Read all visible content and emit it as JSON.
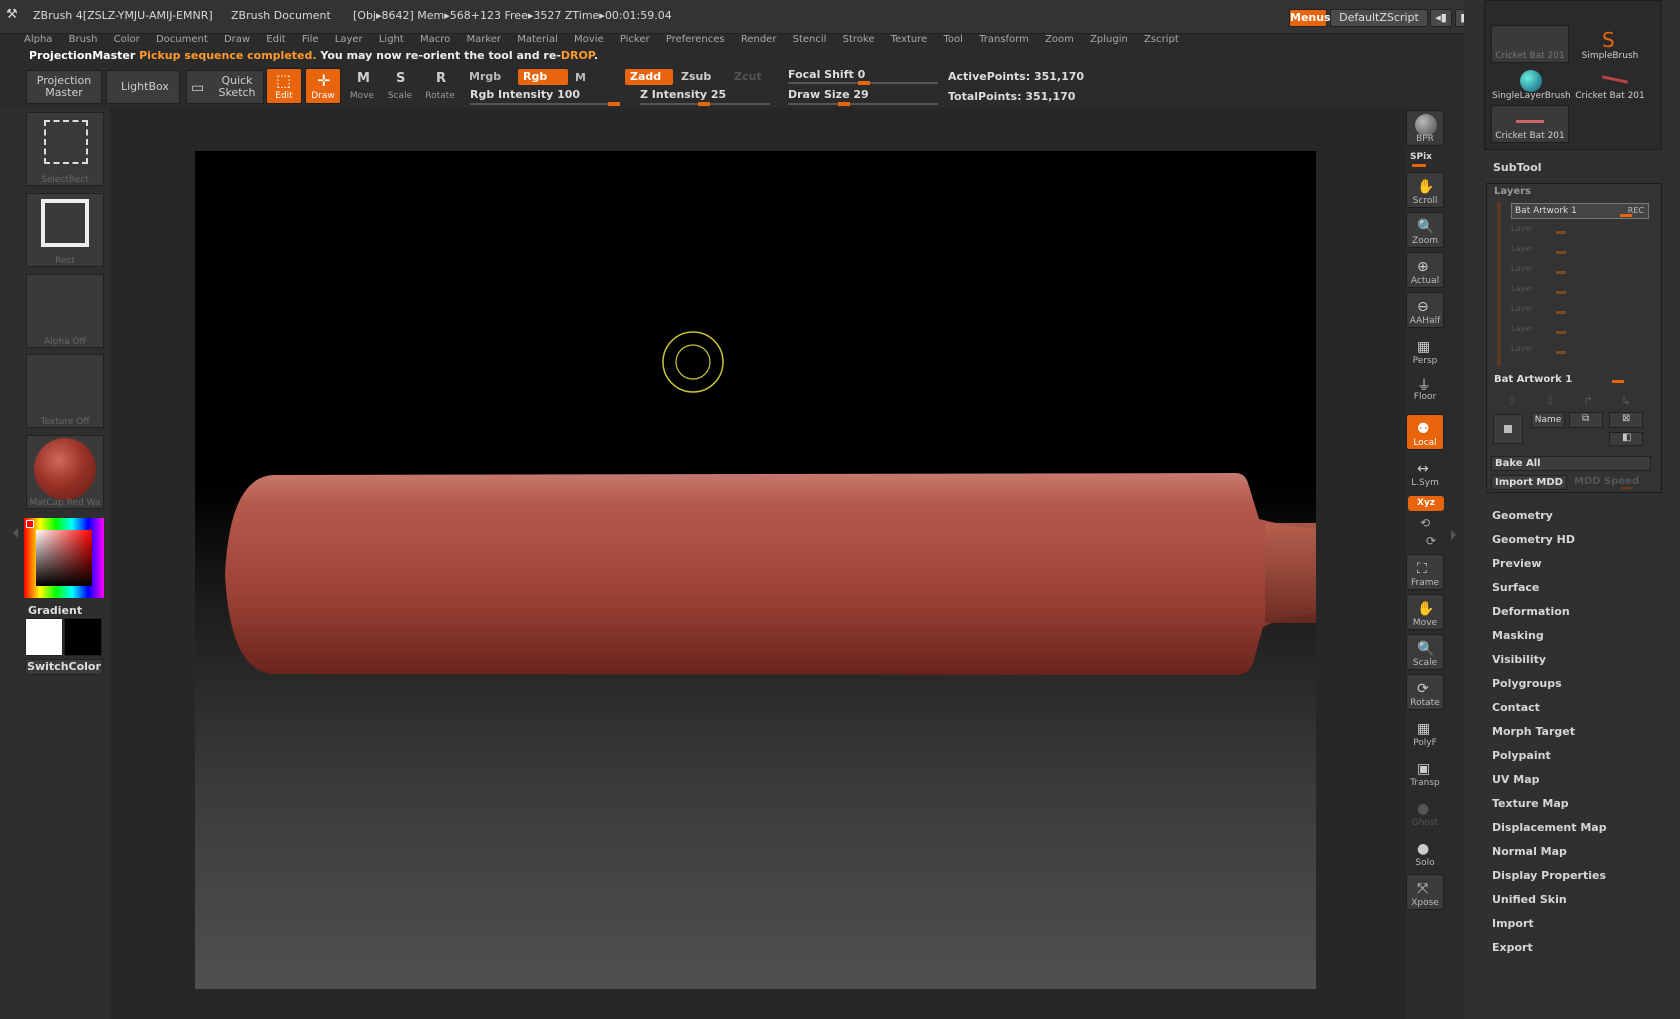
{
  "titlebar": {
    "app": "ZBrush 4[ZSLZ-YMJU-AMIJ-EMNR]",
    "doc": "ZBrush Document",
    "stats": "[Obj▸8642] Mem▸568+123 Free▸3527 ZTime▸00:01:59.04",
    "menus_btn": "Menus",
    "script_btn": "DefaultZScript"
  },
  "menubar": [
    "Alpha",
    "Brush",
    "Color",
    "Document",
    "Draw",
    "Edit",
    "File",
    "Layer",
    "Light",
    "Macro",
    "Marker",
    "Material",
    "Movie",
    "Picker",
    "Preferences",
    "Render",
    "Stencil",
    "Stroke",
    "Texture",
    "Tool",
    "Transform",
    "Zoom",
    "Zplugin",
    "Zscript"
  ],
  "notify": {
    "prefix": "ProjectionMaster",
    "highlight": "Pickup sequence completed.",
    "middle": "You may now re-orient the tool and re-",
    "highlight2": "DROP",
    "end": "."
  },
  "shelf": {
    "projection_master": "Projection Master",
    "lightbox": "LightBox",
    "quick_sketch": "Quick Sketch",
    "edit": "Edit",
    "draw": "Draw",
    "move": "Move",
    "scale": "Scale",
    "rotate": "Rotate",
    "mrgb": "Mrgb",
    "rgb": "Rgb",
    "m": "M",
    "zadd": "Zadd",
    "zsub": "Zsub",
    "zcut": "Zcut",
    "rgb_intensity": "Rgb Intensity 100",
    "z_intensity": "Z Intensity 25",
    "focal_shift": "Focal Shift 0",
    "draw_size": "Draw Size 29",
    "active_points": "ActivePoints: 351,170",
    "total_points": "TotalPoints: 351,170"
  },
  "lefttray": {
    "selectrect": "SelectRect",
    "rect": "Rect",
    "alpha": "Alpha Off",
    "texture": "Texture Off",
    "matcap": "MatCap Red Wa",
    "gradient": "Gradient",
    "switchcolor": "SwitchColor"
  },
  "righttool": [
    "BPR",
    "SPix",
    "Scroll",
    "Zoom",
    "Actual",
    "AAHalf",
    "Persp",
    "Floor",
    "Local",
    "L.Sym",
    "Xyz",
    "Frame",
    "Move",
    "Scale",
    "Rotate",
    "PolyF",
    "Transp",
    "Ghost",
    "Solo",
    "Xpose"
  ],
  "rpanel": {
    "brushes": {
      "cricket_bat_1": "Cricket Bat 201",
      "simple_brush": "SimpleBrush",
      "single_layer": "SingleLayerBrush",
      "cricket_bat_2": "Cricket Bat 201",
      "cricket_bat_3": "Cricket Bat 201"
    },
    "subtool": "SubTool",
    "layers": "Layers",
    "layer_active": "Bat Artwork 1",
    "layer_rec": "REC",
    "layer_placeholder": "Layer",
    "layer_name_row": "Bat Artwork 1",
    "name_btn": "Name",
    "bake_all": "Bake All",
    "import_mdd": "Import MDD",
    "mdd_speed": "MDD Speed",
    "menu": [
      "Geometry",
      "Geometry HD",
      "Preview",
      "Surface",
      "Deformation",
      "Masking",
      "Visibility",
      "Polygroups",
      "Contact",
      "Morph Target",
      "Polypaint",
      "UV Map",
      "Texture Map",
      "Displacement Map",
      "Normal Map",
      "Display Properties",
      "Unified Skin",
      "Import",
      "Export"
    ]
  },
  "colors": {
    "accent": "#e8650e",
    "highlight_text": "#ff9a2e",
    "bat": "#9a3f34"
  }
}
